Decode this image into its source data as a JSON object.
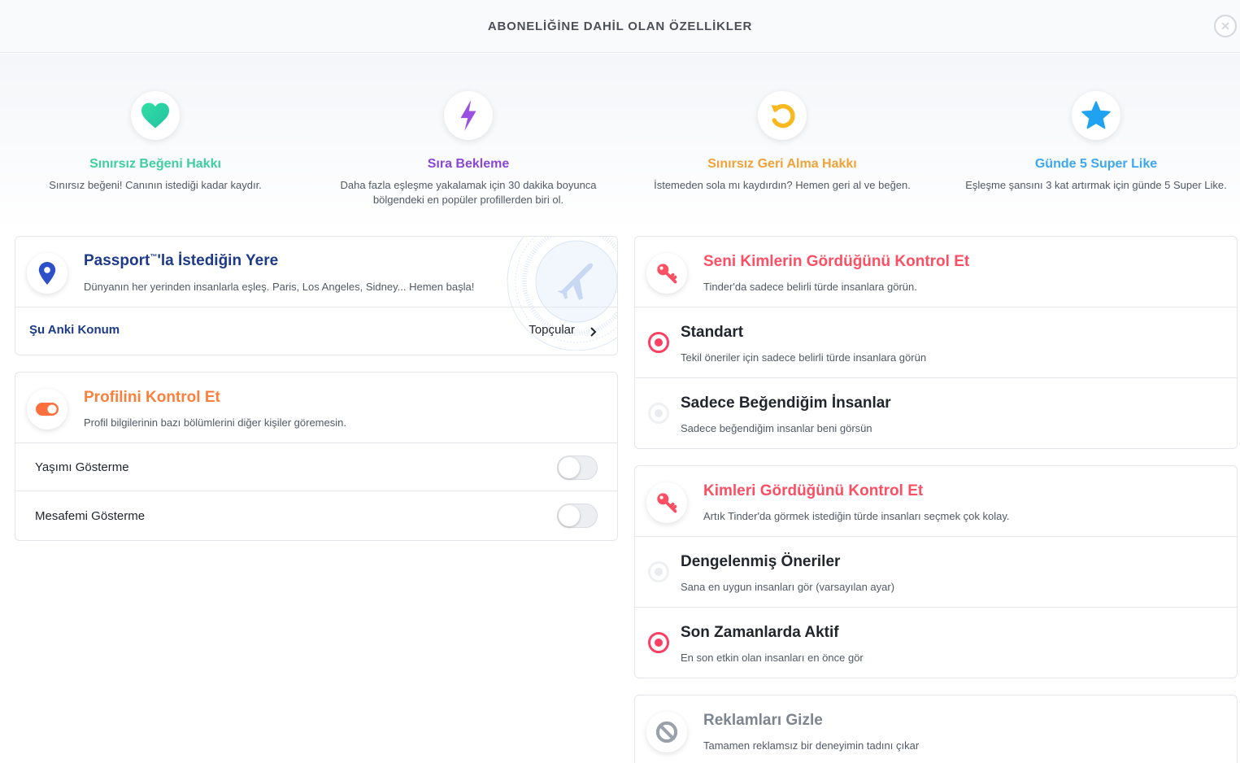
{
  "header": {
    "title": "ABONELİĞİNE DAHİL OLAN ÖZELLİKLER",
    "close_label": "✕"
  },
  "features": [
    {
      "title": "Sınırsız Beğeni Hakkı",
      "desc": "Sınırsız beğeni! Canının istediği kadar kaydır.",
      "color": "#3ecf9e",
      "icon": "heart-icon"
    },
    {
      "title": "Sıra Bekleme",
      "desc": "Daha fazla eşleşme yakalamak için 30 dakika boyunca bölgendeki en popüler profillerden biri ol.",
      "color": "#8a46d6",
      "icon": "lightning-icon"
    },
    {
      "title": "Sınırsız Geri Alma Hakkı",
      "desc": "İstemeden sola mı kaydırdın? Hemen geri al ve beğen.",
      "color": "#f0a23a",
      "icon": "rewind-icon"
    },
    {
      "title": "Günde 5 Super Like",
      "desc": "Eşleşme şansını 3 kat artırmak için günde 5 Super Like.",
      "color": "#3aa7f0",
      "icon": "star-icon"
    }
  ],
  "passport": {
    "title_main": "Passport",
    "title_tm": "™",
    "title_rest": "'la İstediğin Yere",
    "desc": "Dünyanın her yerinden insanlarla eşleş. Paris, Los Angeles, Sidney... Hemen başla!",
    "row_label": "Şu Anki Konum",
    "row_value": "Topçular",
    "color": "#1d3a8a",
    "icon": "location-pin-icon"
  },
  "profile_control": {
    "title": "Profilini Kontrol Et",
    "desc": "Profil bilgilerinin bazı bölümlerini diğer kişiler göremesin.",
    "color": "#fd7f3c",
    "icon": "toggle-icon",
    "options": [
      {
        "label": "Yaşımı Gösterme",
        "enabled": false
      },
      {
        "label": "Mesafemi Gösterme",
        "enabled": false
      }
    ]
  },
  "who_sees_you": {
    "title": "Seni Kimlerin Gördüğünü Kontrol Et",
    "desc": "Tinder'da sadece belirli türde insanlara görün.",
    "color": "#fd4f64",
    "icon": "key-icon",
    "options": [
      {
        "label": "Standart",
        "desc": "Tekil öneriler için sadece belirli türde insanlara görün",
        "selected": true
      },
      {
        "label": "Sadece Beğendiğim İnsanlar",
        "desc": "Sadece beğendiğim insanlar beni görsün",
        "selected": false
      }
    ]
  },
  "who_you_see": {
    "title": "Kimleri Gördüğünü Kontrol Et",
    "desc": "Artık Tinder'da görmek istediğin türde insanları seçmek çok kolay.",
    "color": "#fd4f64",
    "icon": "key-icon",
    "options": [
      {
        "label": "Dengelenmiş Öneriler",
        "desc": "Sana en uygun insanları gör (varsayılan ayar)",
        "selected": false
      },
      {
        "label": "Son Zamanlarda Aktif",
        "desc": "En son etkin olan insanları en önce gör",
        "selected": true
      }
    ]
  },
  "hide_ads": {
    "title": "Reklamları Gizle",
    "desc": "Tamamen reklamsız bir deneyimin tadını çıkar",
    "color": "#7d8590",
    "icon": "no-ads-icon"
  }
}
